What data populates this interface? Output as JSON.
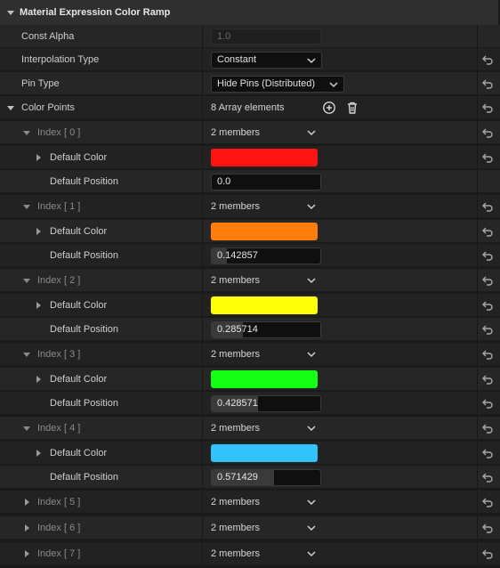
{
  "header": {
    "title": "Material Expression Color Ramp"
  },
  "props": {
    "const_alpha": {
      "label": "Const Alpha",
      "value": "1.0"
    },
    "interp": {
      "label": "Interpolation Type",
      "value": "Constant"
    },
    "pin_type": {
      "label": "Pin Type",
      "value": "Hide Pins (Distributed)"
    },
    "color_points": {
      "label": "Color Points",
      "value": "8 Array elements"
    }
  },
  "labels": {
    "default_color": "Default Color",
    "default_position": "Default Position",
    "members": "2 members"
  },
  "items": [
    {
      "index": "Index [ 0 ]",
      "color": "#ff1414",
      "position": "0.0",
      "pos_value": 0.0
    },
    {
      "index": "Index [ 1 ]",
      "color": "#ff7d0a",
      "position": "0.142857",
      "pos_value": 0.142857
    },
    {
      "index": "Index [ 2 ]",
      "color": "#ffff0a",
      "position": "0.285714",
      "pos_value": 0.285714
    },
    {
      "index": "Index [ 3 ]",
      "color": "#14ff14",
      "position": "0.428571",
      "pos_value": 0.428571
    },
    {
      "index": "Index [ 4 ]",
      "color": "#32c3ff",
      "position": "0.571429",
      "pos_value": 0.571429
    },
    {
      "index": "Index [ 5 ]"
    },
    {
      "index": "Index [ 6 ]"
    },
    {
      "index": "Index [ 7 ]"
    }
  ]
}
